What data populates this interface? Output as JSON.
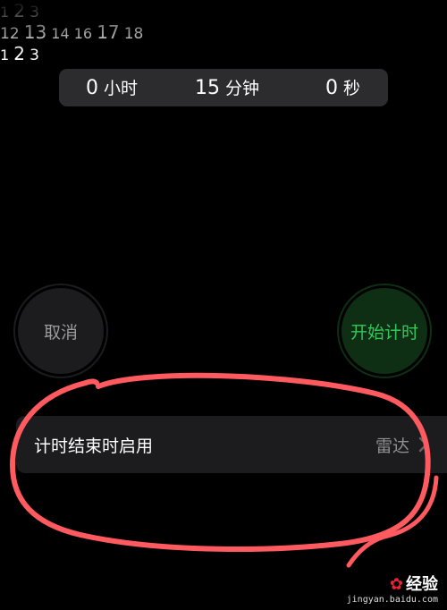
{
  "picker": {
    "hours": {
      "above": [],
      "selected": "0",
      "unit": "小时",
      "below": [
        "1",
        "2",
        "3"
      ]
    },
    "minutes": {
      "above": [
        "12",
        "13",
        "14"
      ],
      "selected": "15",
      "unit": "分钟",
      "below": [
        "16",
        "17",
        "18"
      ]
    },
    "seconds": {
      "above": [],
      "selected": "0",
      "unit": "秒",
      "below": [
        "1",
        "2",
        "3"
      ]
    }
  },
  "buttons": {
    "cancel_label": "取消",
    "start_label": "开始计时"
  },
  "row": {
    "label": "计时结束时启用",
    "value": "雷达"
  },
  "colors": {
    "start_text": "#34c759",
    "start_bg": "#0e2f14",
    "annotation": "#ff5a5f"
  },
  "watermark": {
    "logo_text": "经验",
    "url": "jingyan.baidu.com"
  }
}
